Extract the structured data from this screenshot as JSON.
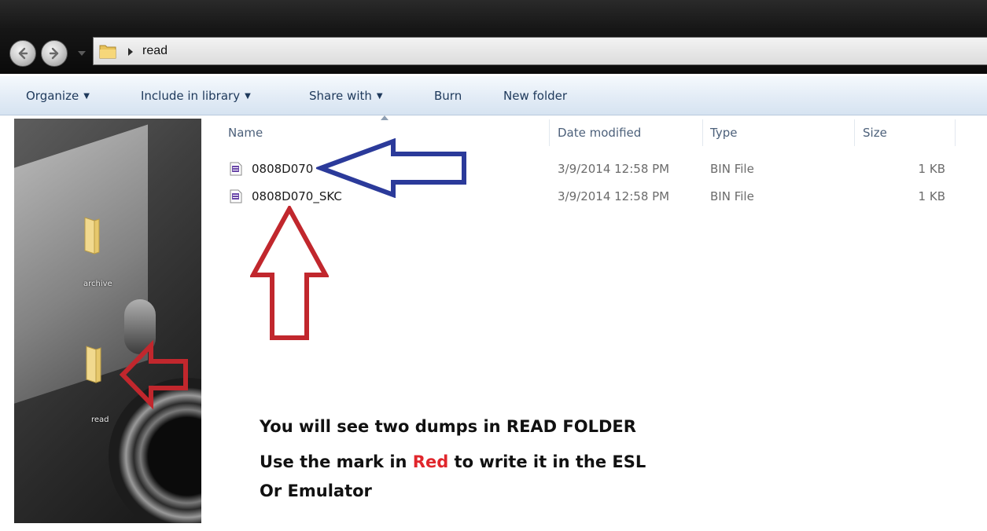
{
  "address_bar": {
    "path_segment": "read"
  },
  "toolbar": {
    "organize_label": "Organize",
    "include_label": "Include in library",
    "share_label": "Share with",
    "burn_label": "Burn",
    "new_folder_label": "New folder"
  },
  "nav_pane": {
    "folders": [
      {
        "label": "archive"
      },
      {
        "label": "read"
      }
    ]
  },
  "file_list": {
    "columns": {
      "name": "Name",
      "date_modified": "Date modified",
      "type": "Type",
      "size": "Size"
    },
    "rows": [
      {
        "name": "0808D070",
        "date": "3/9/2014 12:58 PM",
        "type": "BIN File",
        "size": "1 KB"
      },
      {
        "name": "0808D070_SKC",
        "date": "3/9/2014 12:58 PM",
        "type": "BIN File",
        "size": "1 KB"
      }
    ]
  },
  "annotation": {
    "line1": "You will see two dumps in READ FOLDER",
    "line2_pre": "Use the mark in ",
    "line2_red": "Red",
    "line2_post": " to write it in the ESL",
    "line3": "Or Emulator"
  },
  "colors": {
    "toolbar_text": "#1e395b",
    "annotation_red": "#e0262c",
    "annotation_blue": "#2b3a9a",
    "arrow_red": "#c1272d"
  },
  "icons": {
    "back": "back-arrow-icon",
    "forward": "forward-arrow-icon",
    "address_folder": "folder-icon",
    "file": "bin-file-icon"
  }
}
